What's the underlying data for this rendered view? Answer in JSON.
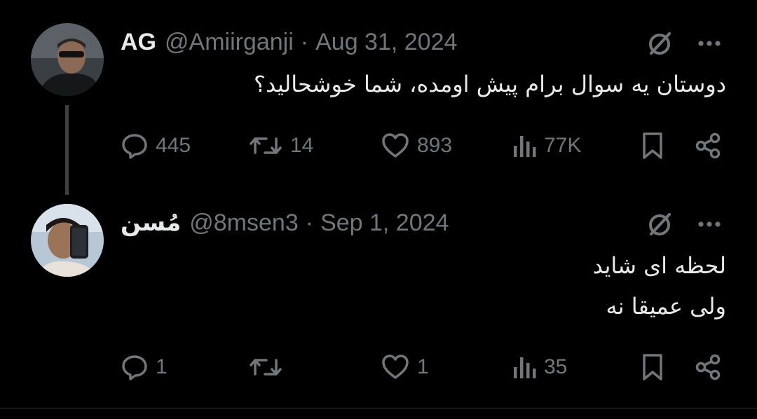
{
  "colors": {
    "background": "#000000",
    "primary_text": "#e7e9ea",
    "secondary_text": "#71767b",
    "thread_line": "#3e4144"
  },
  "tweets": [
    {
      "display_name": "AG",
      "handle": "@Amiirganji",
      "separator": "·",
      "date": "Aug 31, 2024",
      "text_lines": [
        "دوستان یه سوال برام پیش اومده، شما خوشحالید؟"
      ],
      "counts": {
        "replies": "445",
        "reposts": "14",
        "likes": "893",
        "views": "77K"
      },
      "icons": [
        "grok-icon",
        "more-icon",
        "reply-icon",
        "repost-icon",
        "like-icon",
        "views-icon",
        "bookmark-icon",
        "share-icon"
      ]
    },
    {
      "display_name": "مُسن",
      "handle": "@8msen3",
      "separator": "·",
      "date": "Sep 1, 2024",
      "text_lines": [
        "لحظه ای شاید",
        "ولی عمیقا نه"
      ],
      "counts": {
        "replies": "1",
        "reposts": "",
        "likes": "1",
        "views": "35"
      },
      "icons": [
        "grok-icon",
        "more-icon",
        "reply-icon",
        "repost-icon",
        "like-icon",
        "views-icon",
        "bookmark-icon",
        "share-icon"
      ]
    }
  ]
}
